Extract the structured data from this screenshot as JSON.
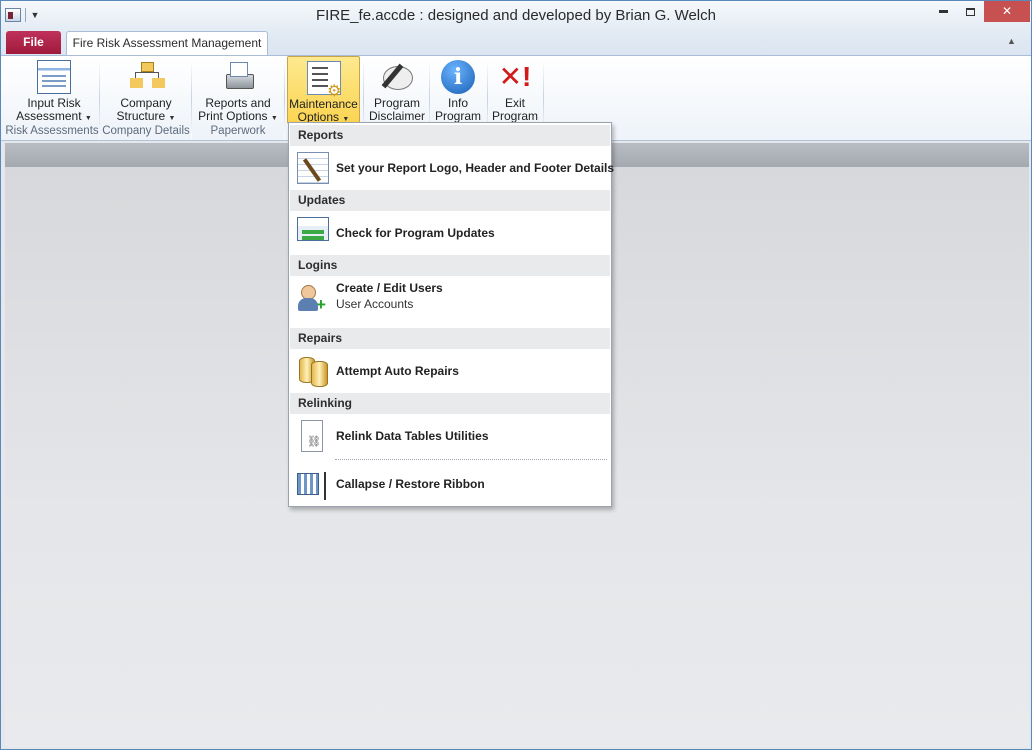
{
  "window": {
    "title": "FIRE_fe.accde : designed and developed by Brian G. Welch"
  },
  "tabs": {
    "file": "File",
    "main": "Fire Risk Assessment Management"
  },
  "ribbon": {
    "buttons": [
      {
        "line1": "Input Risk",
        "line2": "Assessment"
      },
      {
        "line1": "Company",
        "line2": "Structure"
      },
      {
        "line1": "Reports and",
        "line2": "Print Options"
      },
      {
        "line1": "Maintenance",
        "line2": "Options"
      },
      {
        "line1": "Program",
        "line2": "Disclaimer"
      },
      {
        "line1": "Info",
        "line2": "Program"
      },
      {
        "line1": "Exit",
        "line2": "Program"
      }
    ],
    "groups": [
      "Risk Assessments",
      "Company Details",
      "Paperwork"
    ]
  },
  "menu": {
    "sections": [
      {
        "header": "Reports",
        "item": "Set your Report Logo, Header and Footer Details"
      },
      {
        "header": "Updates",
        "item": "Check for Program Updates"
      },
      {
        "header": "Logins",
        "item": "Create / Edit Users",
        "sub": "User Accounts"
      },
      {
        "header": "Repairs",
        "item": "Attempt Auto Repairs"
      },
      {
        "header": "Relinking",
        "item": "Relink Data Tables Utilities"
      }
    ],
    "footer_item": "Callapse / Restore Ribbon"
  },
  "colors": {
    "file_tab": "#b02548",
    "active_button": "#fbd451",
    "close_button": "#c75050"
  }
}
